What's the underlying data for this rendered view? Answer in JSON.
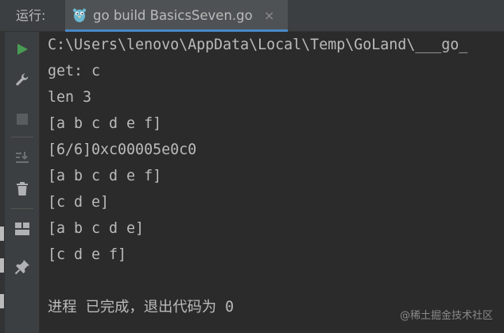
{
  "header": {
    "run_label": "运行:",
    "tab_title": "go build BasicsSeven.go",
    "close_glyph": "×"
  },
  "toolbar": {
    "items": [
      {
        "name": "run-icon"
      },
      {
        "name": "wrench-icon"
      },
      {
        "name": "stop-icon"
      },
      {
        "name": "scroll-to-end-icon"
      },
      {
        "name": "trash-icon"
      },
      {
        "name": "layout-icon"
      },
      {
        "name": "pin-icon"
      }
    ]
  },
  "console": {
    "lines": [
      "C:\\Users\\lenovo\\AppData\\Local\\Temp\\GoLand\\___go_",
      "get: c",
      "len 3",
      "[a b c d e f]",
      "[6/6]0xc00005e0c0",
      "[a b c d e f]",
      "[c d e]",
      "[a b c d e]",
      "[c d e f]",
      "",
      "进程 已完成，退出代码为 0"
    ]
  },
  "watermark": "@稀土掘金技术社区",
  "colors": {
    "background": "#2b2b2b",
    "panel": "#3c3f41",
    "text": "#bbbbbb",
    "run_green": "#499c54",
    "tab_underline": "#4a88c7"
  }
}
